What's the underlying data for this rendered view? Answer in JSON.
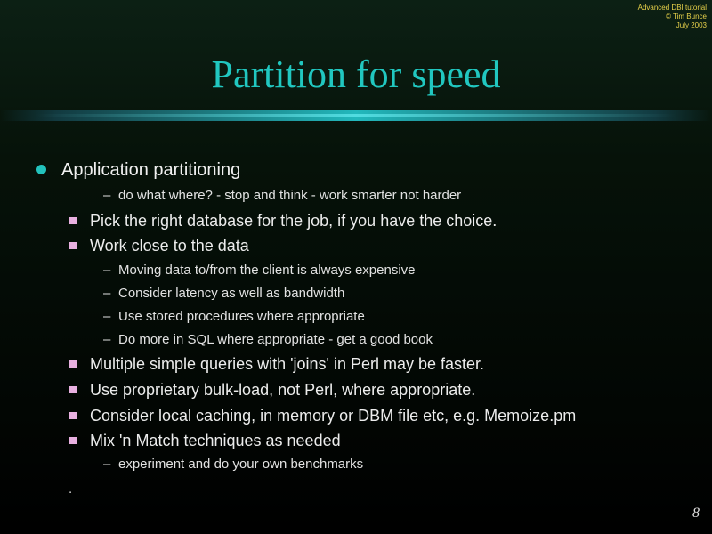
{
  "corner_note": {
    "line1": "Advanced DBI tutorial",
    "line2": "© Tim Bunce",
    "line3": "July 2003"
  },
  "title": "Partition for speed",
  "items": [
    {
      "level": 1,
      "text": "Application partitioning"
    },
    {
      "level": 3,
      "text": "do what where? - stop and think - work smarter not harder"
    },
    {
      "level": 2,
      "text": "Pick the right database for the job, if you have the choice."
    },
    {
      "level": 2,
      "text": "Work close to the data"
    },
    {
      "level": 3,
      "text": "Moving data to/from the client is always expensive"
    },
    {
      "level": 3,
      "text": "Consider latency as well as bandwidth"
    },
    {
      "level": 3,
      "text": "Use stored procedures where appropriate"
    },
    {
      "level": 3,
      "text": "Do more in SQL where appropriate - get a good book"
    },
    {
      "level": 2,
      "text": "Multiple simple queries with 'joins' in Perl may be faster."
    },
    {
      "level": 2,
      "text": "Use proprietary bulk-load, not Perl, where appropriate."
    },
    {
      "level": 2,
      "text": "Consider local caching, in memory or DBM file etc, e.g. Memoize.pm"
    },
    {
      "level": 2,
      "text": "Mix 'n Match techniques as needed"
    },
    {
      "level": 3,
      "text": "experiment and do your own benchmarks"
    }
  ],
  "trailing_mark": ".",
  "level3_bullet": "–",
  "page_number": "8"
}
